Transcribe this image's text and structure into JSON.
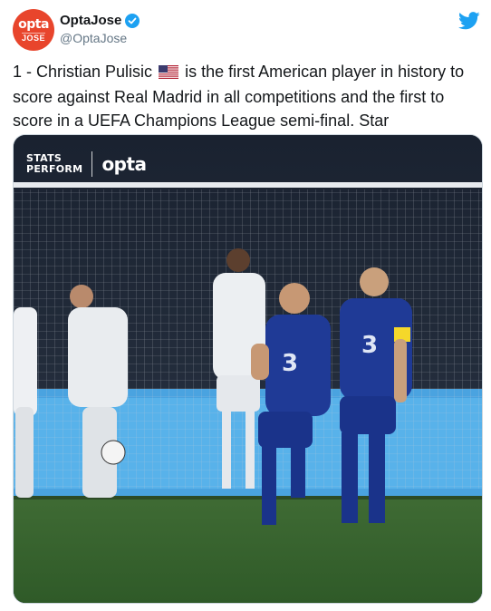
{
  "account": {
    "display_name": "OptaJose",
    "handle": "@OptaJose",
    "verified": true,
    "avatar_brand": "opta",
    "avatar_sub": "JOSE",
    "avatar_color": "#e8452c"
  },
  "platform_icon": "twitter-bird-icon",
  "tweet": {
    "text_before_flag": "1 - Christian Pulisic",
    "flag_icon": "us-flag-icon",
    "text_after_flag": "is the first American player in history to score against Real Madrid in all competitions and the first to score in a UEFA Champions League semi-final. Star"
  },
  "media": {
    "watermark_left": "STATS\nPERFORM",
    "watermark_right": "opta"
  },
  "colors": {
    "accent_blue": "#1da1f2",
    "text": "#14171a",
    "secondary": "#657786"
  }
}
